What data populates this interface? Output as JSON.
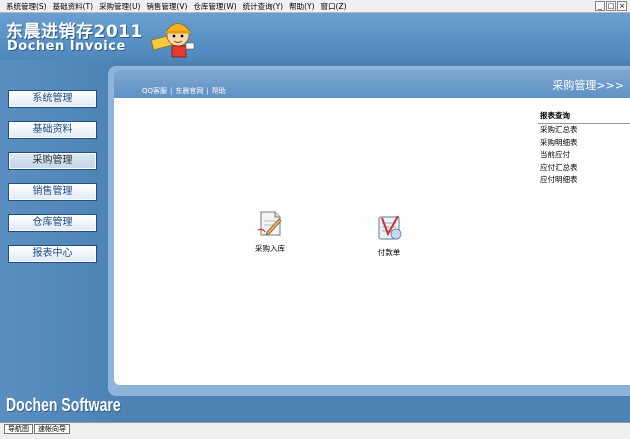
{
  "menubar": {
    "items": [
      "系统管理(S)",
      "基础资料(T)",
      "采购管理(U)",
      "销售管理(V)",
      "仓库管理(W)",
      "统计查询(Y)",
      "帮助(Y)",
      "窗口(Z)"
    ],
    "window_controls": [
      "_",
      "□",
      "×"
    ]
  },
  "header": {
    "logo_cn": "东晨进销存2011",
    "logo_en": "Dochen Invoice"
  },
  "sidebar": {
    "items": [
      {
        "label": "系统管理"
      },
      {
        "label": "基础资料"
      },
      {
        "label": "采购管理"
      },
      {
        "label": "销售管理"
      },
      {
        "label": "仓库管理"
      },
      {
        "label": "报表中心"
      }
    ],
    "active_index": 2,
    "brand": "Dochen Software"
  },
  "main": {
    "links": [
      "QQ客服",
      "东晨官网",
      "帮助"
    ],
    "link_separator": "|",
    "section_title": "采购管理>>>",
    "report": {
      "title": "报表查询",
      "items": [
        "采购汇总表",
        "采购明细表",
        "当前应付",
        "应付汇总表",
        "应付明细表"
      ]
    },
    "functions": [
      {
        "label": "采购入库",
        "icon": "document-edit-icon"
      },
      {
        "label": "付款单",
        "icon": "payment-check-icon"
      }
    ]
  },
  "status": {
    "tabs": [
      "导航图",
      "速帐向导"
    ]
  },
  "colors": {
    "background": "#4d82b5",
    "panel": "#8fb4d8",
    "button_text": "#1d4c86"
  }
}
